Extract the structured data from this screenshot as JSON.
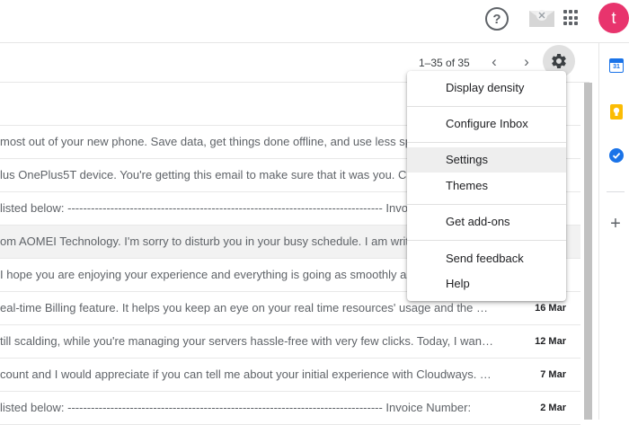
{
  "header": {
    "help_label": "?",
    "avatar_letter": "t"
  },
  "toolbar": {
    "page_count": "1–35 of 35",
    "prev_symbol": "‹",
    "next_symbol": "›"
  },
  "emails": [
    {
      "snippet": "most out of your new phone. Save data, get things done offline, and use less space",
      "date": ""
    },
    {
      "snippet": "lus OnePlus5T device. You're getting this email to make sure that it was you. Ch",
      "date": ""
    },
    {
      "snippet": "listed below: --------------------------------------------------------------------------------- Invoice Number",
      "date": ""
    },
    {
      "snippet": "om AOMEI Technology. I'm sorry to disturb you in your busy schedule. I am writing",
      "date": ""
    },
    {
      "snippet": "I hope you are enjoying your experience and everything is going as smoothly as",
      "date": ""
    },
    {
      "snippet": "eal-time Billing feature. It helps you keep an eye on your real time resources' usage and the est…",
      "date": "16 Mar"
    },
    {
      "snippet": "till scalding, while you're managing your servers hassle-free with very few clicks. Today, I wan…",
      "date": "12 Mar"
    },
    {
      "snippet": "count and I would appreciate if you can tell me about your initial experience with Cloudways. T…",
      "date": "7 Mar"
    },
    {
      "snippet": "listed below: --------------------------------------------------------------------------------- Invoice Number:",
      "date": "2 Mar"
    }
  ],
  "settings_menu": {
    "display_density": "Display density",
    "configure_inbox": "Configure Inbox",
    "settings": "Settings",
    "themes": "Themes",
    "get_addons": "Get add-ons",
    "send_feedback": "Send feedback",
    "help": "Help"
  },
  "side_panel": {
    "calendar_day": "31",
    "add_symbol": "+"
  },
  "colors": {
    "avatar": "#e8346d",
    "accent_blue": "#1a73e8",
    "keep_yellow": "#fbbc04"
  },
  "icons": [
    "help-icon",
    "mail-icon",
    "apps-grid-icon",
    "chevron-left-icon",
    "chevron-right-icon",
    "gear-icon",
    "calendar-icon",
    "keep-icon",
    "tasks-icon",
    "plus-icon"
  ]
}
